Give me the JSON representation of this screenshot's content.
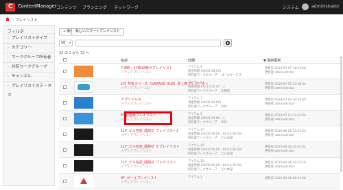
{
  "app": {
    "name": "ContentManager",
    "logo_letter": "C"
  },
  "nav": {
    "links": [
      "コンテンツ",
      "プランニング",
      "ネットワーク"
    ],
    "system": "システム",
    "user": "administrator"
  },
  "breadcrumb": {
    "current": "プレイリスト"
  },
  "sidebar": {
    "header": "フィルタ",
    "items": [
      "プレイリストタイプ",
      "カテゴリー",
      "ワークグループ所有者",
      "共有ワークグループ",
      "チャンネル",
      "プレイリストステータス"
    ]
  },
  "toolbar": {
    "new_label": "+ 新規",
    "new_smart_label": "新しいスマートプレイリスト"
  },
  "filter": {
    "page_size": "50",
    "search_placeholder": ""
  },
  "results": {
    "count": "32 の 1 から 32 へ"
  },
  "table": {
    "headers": {
      "name": "名前",
      "detail": "詳細",
      "updated": "▼ 最終更新"
    },
    "rows": [
      {
        "thumb_color": "#f08a3c",
        "title": "7-8時・17時18時ザプレイリスト",
        "subtitle": "メディアプレイリスト",
        "items": "アイテム 4",
        "duration": "再生時間 (00:02:28.05)",
        "workgroup": "所有者ワークグループ 　ゴールサービス",
        "updated_date": "更新日 2019-07-07 16:14:28",
        "updated_by": "更新者 administrator"
      },
      {
        "thumb_color": "#3a9bd4",
        "title": "1日 共有スペース（GARAGE HUB）未上映プレイリスト",
        "subtitle": "メディアプレイリスト",
        "items": "アイテム 13",
        "duration": "再生時間 (00:10:12.47 ...)",
        "workgroup": "所有者ワークグループ 　広報部",
        "updated_date": "更新日 2019-07-05 20:38:04",
        "updated_by": "更新者 administrator"
      },
      {
        "thumb_color": "#2a7fd0",
        "title": "アプリドルる",
        "subtitle": "メディアプレイリスト",
        "items": "アイテム 3",
        "duration": "再生時間 (00:00:44.00)",
        "workgroup": "所有者ワークグループ 　DRP",
        "updated_date": "更新日 2019-07-04 20:43:35",
        "updated_by": "更新者 administrator"
      },
      {
        "thumb_color": "#3c92d6",
        "title": "M_顧客様プレイリスト",
        "subtitle": "メディアプレイリスト",
        "items": "アイテム 5",
        "duration": "再生時間 (00:04:19.60 ...)",
        "workgroup": "所有者ワークグループ 　DRP",
        "updated_date": "更新日 2019-07-03 22:24:24",
        "updated_by": "更新者 administrator"
      },
      {
        "thumb_color": "#1a1a1a",
        "title": "11F_ビル名前_開館計 プレイリスト1",
        "subtitle": "メディアプレイリスト",
        "items": "アイテム 10",
        "duration": "再生時間 (00:02:56.00 - 00:03:56.00)",
        "workgroup": "所有者ワークグループ 　ビル本部",
        "updated_date": "更新日 2019-06-26 10:37:23",
        "updated_by": "更新者 administrator"
      },
      {
        "thumb_color": "#1a1a1a",
        "title": "11F_ビル名前_開館計 ケプレイリスト",
        "subtitle": "メディアプレイリスト",
        "items": "アイテム 10",
        "duration": "再生時間 (00:02:56.00 - 00:03:56.00)",
        "workgroup": "所有者ワークグループ 　ビル本部",
        "updated_date": "更新日 2019-06-26 10:35:51",
        "updated_by": "更新者 administrator"
      },
      {
        "thumb_color": "#1a1a1a",
        "title": "11F_ビル名前_開館計 プレイリスト",
        "subtitle": "メディアプレイリスト",
        "items": "アイテム 10",
        "duration": "再生時間 (00:02:56.00 - 00:03:56.00)",
        "workgroup": "所有者ワークグループ 　ビル本部",
        "updated_date": "更新日 2019-06-26 10:35:18",
        "updated_by": "更新者 administrator"
      },
      {
        "thumb_color": "#ffffff",
        "title": "8F_ボールプレイリスト",
        "subtitle": "メディアプレイリスト",
        "items": "アイテム 3",
        "duration": "",
        "workgroup": "",
        "updated_date": "更新日 2019-06-26 08:33:28",
        "updated_by": ""
      }
    ]
  },
  "colors": {
    "brand": "#e0312f",
    "title_link": "#d63b2f",
    "highlight": "#e60012"
  }
}
